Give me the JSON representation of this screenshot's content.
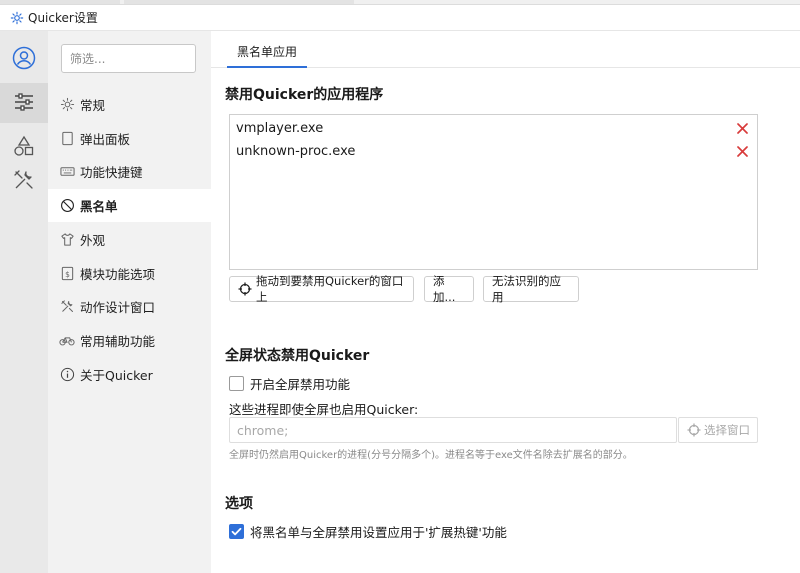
{
  "window": {
    "title": "Quicker设置"
  },
  "rail": [
    {
      "name": "account",
      "icon": "user-circle-icon",
      "active": false
    },
    {
      "name": "settings",
      "icon": "sliders-icon",
      "active": true
    },
    {
      "name": "shapes",
      "icon": "shapes-icon",
      "active": false
    },
    {
      "name": "tools",
      "icon": "tools-icon",
      "active": false
    }
  ],
  "nav": {
    "filter_placeholder": "筛选...",
    "items": [
      {
        "label": "常规",
        "icon": "gear-icon",
        "active": false
      },
      {
        "label": "弹出面板",
        "icon": "panel-icon",
        "active": false
      },
      {
        "label": "功能快捷键",
        "icon": "keyboard-icon",
        "active": false
      },
      {
        "label": "黑名单",
        "icon": "forbidden-icon",
        "active": true
      },
      {
        "label": "外观",
        "icon": "tshirt-icon",
        "active": false
      },
      {
        "label": "模块功能选项",
        "icon": "module-icon",
        "active": false
      },
      {
        "label": "动作设计窗口",
        "icon": "tools-icon",
        "active": false
      },
      {
        "label": "常用辅助功能",
        "icon": "bicycle-icon",
        "active": false
      },
      {
        "label": "关于Quicker",
        "icon": "info-icon",
        "active": false
      }
    ]
  },
  "main": {
    "tab": "黑名单应用",
    "section1": {
      "title": "禁用Quicker的应用程序",
      "list": [
        "vmplayer.exe",
        "unknown-proc.exe"
      ],
      "drag_button": "拖动到要禁用Quicker的窗口上",
      "add_button": "添加...",
      "unknown_button": "无法识别的应用"
    },
    "section2": {
      "title": "全屏状态禁用Quicker",
      "enable_label": "开启全屏禁用功能",
      "enable_checked": false,
      "process_label": "这些进程即使全屏也启用Quicker:",
      "process_placeholder": "chrome;",
      "pick_button": "选择窗口",
      "hint": "全屏时仍然启用Quicker的进程(分号分隔多个)。进程名等于exe文件名除去扩展名的部分。"
    },
    "section3": {
      "title": "选项",
      "option_label": "将黑名单与全屏禁用设置应用于'扩展热键'功能",
      "option_checked": true
    }
  },
  "colors": {
    "accent": "#2e6fd8",
    "remove": "#d83b3b",
    "rail_bg": "#e9e9e9",
    "nav_bg": "#f2f2f2"
  }
}
